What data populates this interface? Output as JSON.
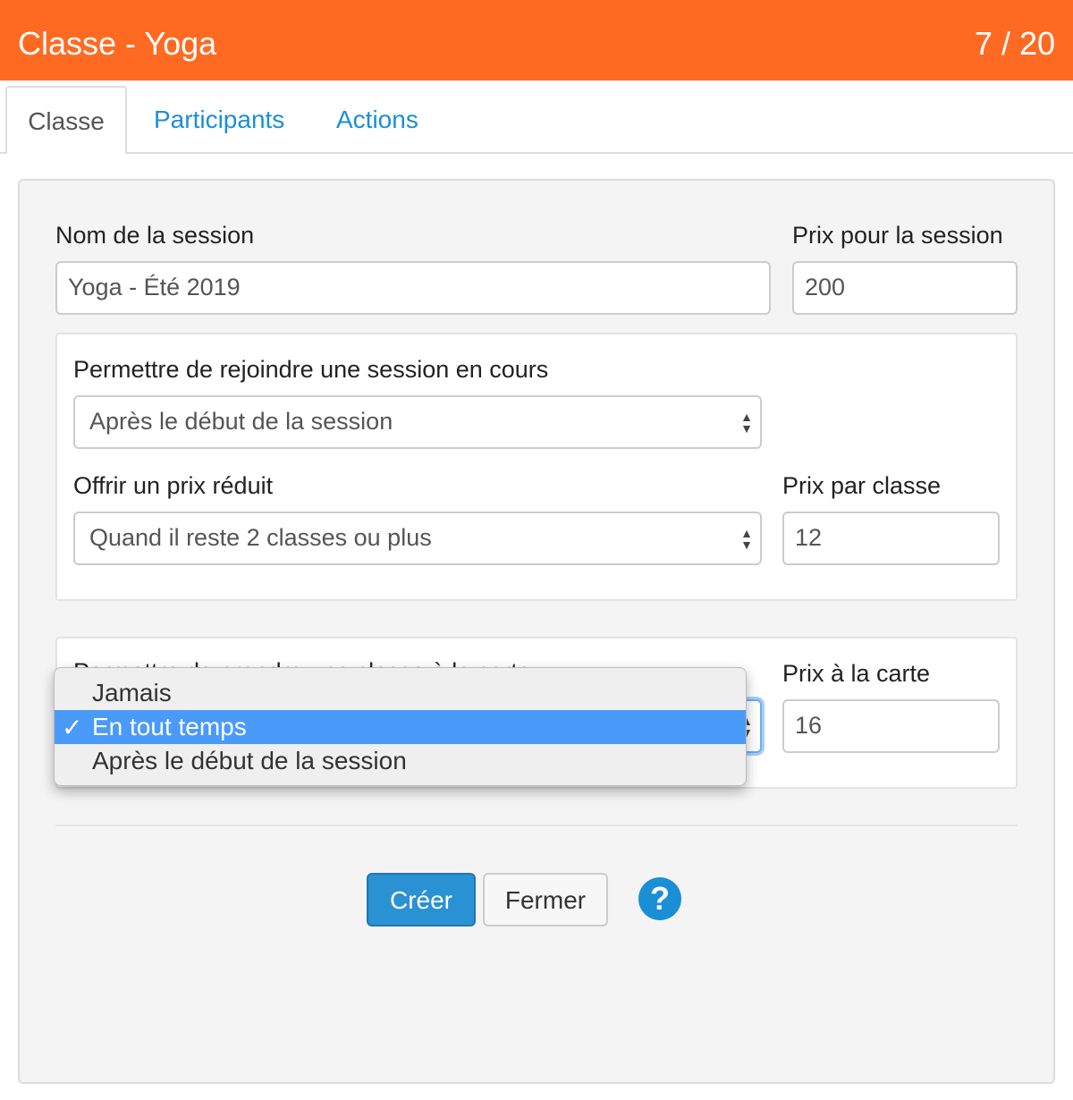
{
  "header": {
    "title": "Classe - Yoga",
    "counter": "7 / 20"
  },
  "tabs": [
    {
      "label": "Classe",
      "active": true
    },
    {
      "label": "Participants"
    },
    {
      "label": "Actions"
    }
  ],
  "form": {
    "session_name_label": "Nom de la session",
    "session_name_value": "Yoga - Été 2019",
    "session_price_label": "Prix pour la session",
    "session_price_value": "200",
    "join_label": "Permettre de rejoindre une session en cours",
    "join_value": "Après le début de la session",
    "discount_label": "Offrir un prix réduit",
    "discount_value": "Quand il reste 2 classes ou plus",
    "class_price_label": "Prix par classe",
    "class_price_value": "12",
    "carte_label": "Permettre de prendre une classe à la carte",
    "carte_price_label": "Prix à la carte",
    "carte_price_value": "16"
  },
  "dropdown": {
    "options": [
      "Jamais",
      "En tout temps",
      "Après le début de la session"
    ],
    "selected": "En tout temps",
    "check": "✓"
  },
  "buttons": {
    "create": "Créer",
    "close": "Fermer",
    "help": "?"
  },
  "colors": {
    "header": "#ff6a22",
    "primary": "#2a92d2",
    "highlight": "#4a9afa"
  }
}
